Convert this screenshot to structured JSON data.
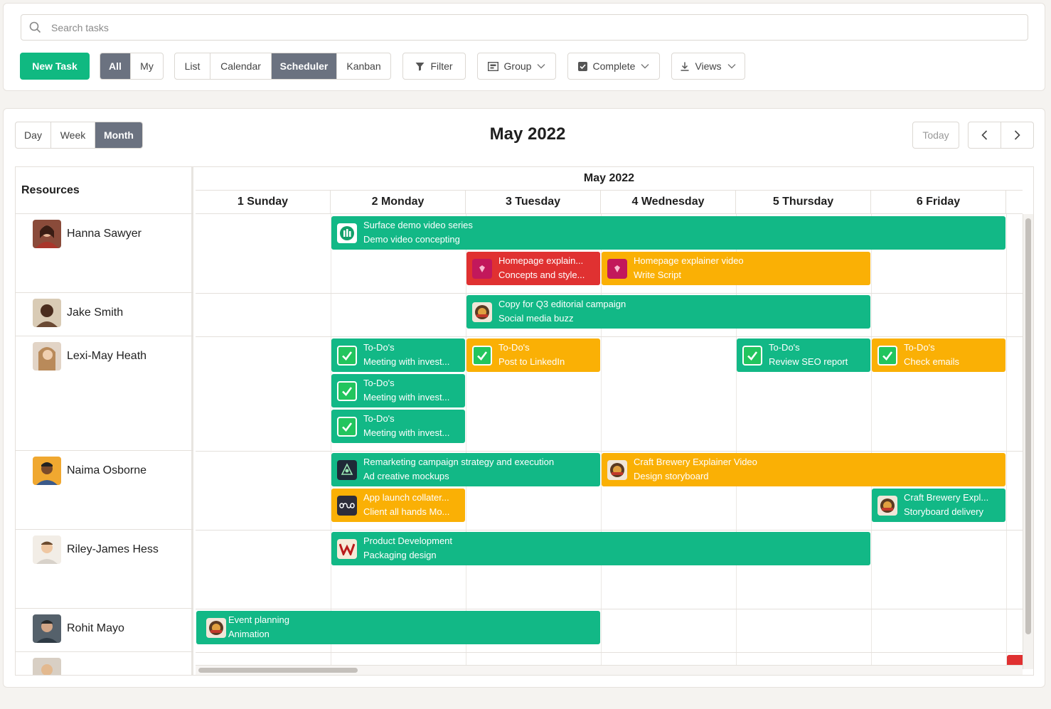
{
  "toolbar": {
    "search_placeholder": "Search tasks",
    "new_task": "New Task",
    "scope": [
      "All",
      "My"
    ],
    "views": [
      "List",
      "Calendar",
      "Scheduler",
      "Kanban"
    ],
    "filter": "Filter",
    "group": "Group",
    "complete": "Complete",
    "views_menu": "Views"
  },
  "scheduler": {
    "ranges": [
      "Day",
      "Week",
      "Month"
    ],
    "title": "May 2022",
    "today": "Today",
    "header_month": "May 2022",
    "resources_header": "Resources",
    "days": [
      "1 Sunday",
      "2 Monday",
      "3 Tuesday",
      "4 Wednesday",
      "5 Thursday",
      "6 Friday"
    ],
    "resources": [
      "Hanna Sawyer",
      "Jake Smith",
      "Lexi-May Heath",
      "Naima Osborne",
      "Riley-James Hess",
      "Rohit Mayo"
    ],
    "events": [
      {
        "title": "Surface demo video series",
        "subtitle": "Demo video concepting",
        "color": "#12b886",
        "icon": "company-logo-icon"
      },
      {
        "title": "Homepage explain...",
        "subtitle": "Concepts and style...",
        "color": "#e03131",
        "icon": "brand-logo-icon"
      },
      {
        "title": "Homepage explainer video",
        "subtitle": "Write Script",
        "color": "#fab005",
        "icon": "brand-logo-icon"
      },
      {
        "title": "Copy for Q3 editorial campaign",
        "subtitle": "Social media buzz",
        "color": "#12b886",
        "icon": "brewery-logo-icon"
      },
      {
        "title": "To-Do's",
        "subtitle": "Meeting with invest...",
        "color": "#12b886",
        "icon": "checkmark-icon"
      },
      {
        "title": "To-Do's",
        "subtitle": "Post to LinkedIn",
        "color": "#fab005",
        "icon": "checkmark-icon"
      },
      {
        "title": "To-Do's",
        "subtitle": "Review SEO report",
        "color": "#12b886",
        "icon": "checkmark-icon"
      },
      {
        "title": "To-Do's",
        "subtitle": "Check emails",
        "color": "#fab005",
        "icon": "checkmark-icon"
      },
      {
        "title": "To-Do's",
        "subtitle": "Meeting with invest...",
        "color": "#12b886",
        "icon": "checkmark-icon"
      },
      {
        "title": "To-Do's",
        "subtitle": "Meeting with invest...",
        "color": "#12b886",
        "icon": "checkmark-icon"
      },
      {
        "title": "Remarketing campaign strategy and execution",
        "subtitle": "Ad creative mockups",
        "color": "#12b886",
        "icon": "dark-logo-icon"
      },
      {
        "title": "Craft Brewery Explainer Video",
        "subtitle": "Design storyboard",
        "color": "#fab005",
        "icon": "brewery-logo-icon"
      },
      {
        "title": "App launch collater...",
        "subtitle": "Client all hands Mo...",
        "color": "#fab005",
        "icon": "infinity-logo-icon"
      },
      {
        "title": "Craft Brewery Expl...",
        "subtitle": "Storyboard delivery",
        "color": "#12b886",
        "icon": "brewery-logo-icon"
      },
      {
        "title": "Product Development",
        "subtitle": "Packaging design",
        "color": "#12b886",
        "icon": "w-logo-icon"
      },
      {
        "title": "Event planning",
        "subtitle": "Animation",
        "color": "#12b886",
        "icon": "brewery-logo-icon"
      }
    ]
  }
}
